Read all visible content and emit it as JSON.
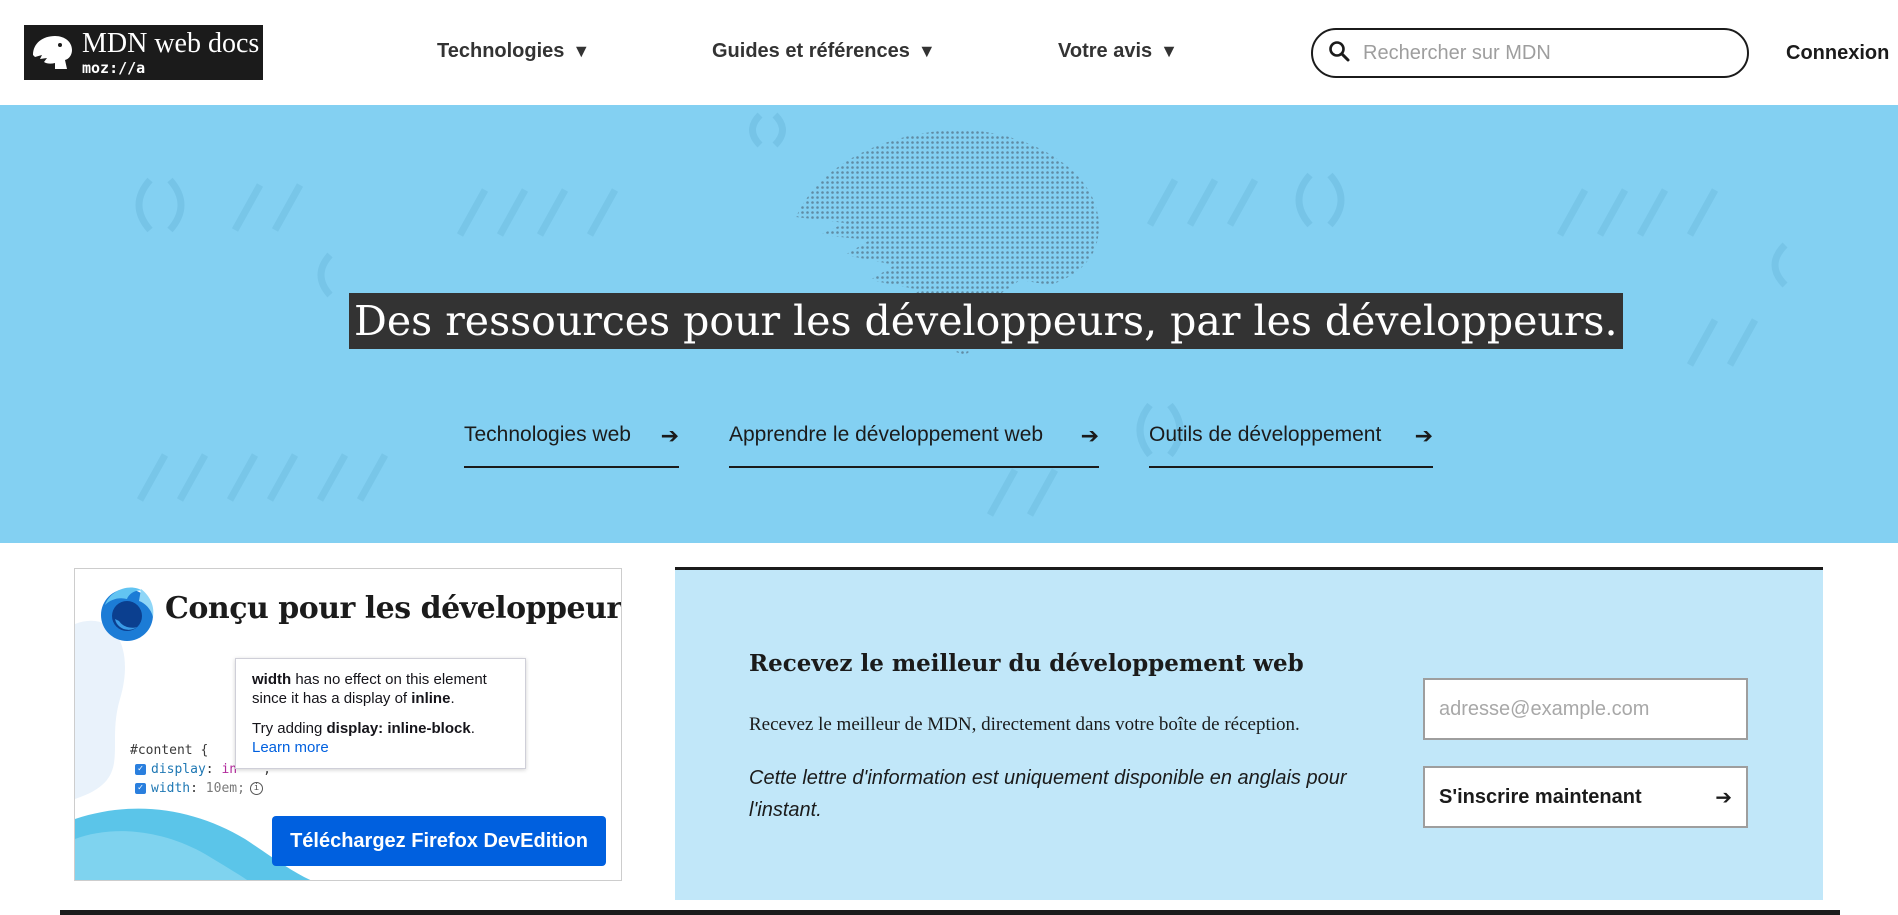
{
  "header": {
    "logo": {
      "title": "MDN web docs",
      "subtitle": "moz://a"
    },
    "nav": [
      {
        "label": "Technologies",
        "caret": "▼"
      },
      {
        "label": "Guides et références",
        "caret": "▼"
      },
      {
        "label": "Votre avis",
        "caret": "▼"
      }
    ],
    "search": {
      "placeholder": "Rechercher sur MDN",
      "icon": "search-icon"
    },
    "login": "Connexion"
  },
  "hero": {
    "title": "Des ressources pour les développeurs, par les développeurs.",
    "links": [
      {
        "label": "Technologies web",
        "arrow": "➔"
      },
      {
        "label": "Apprendre le développement web",
        "arrow": "➔"
      },
      {
        "label": "Outils de développement",
        "arrow": "➔"
      }
    ],
    "background_color": "#83d0f2"
  },
  "promo": {
    "title": "Conçu pour les développeurs",
    "tooltip": {
      "line1_bold": "width",
      "line1_rest": " has no effect on this element since it has a display of ",
      "line1_bold2": "inline",
      "line1_end": ".",
      "line2_start": "Try adding ",
      "line2_bold": "display: inline-block",
      "line2_end": ".",
      "learn_more": "Learn more"
    },
    "code": {
      "selector": "#content {",
      "prop1": "display",
      "val1": "in",
      "val1_tail": ";",
      "prop2": "width",
      "val2": "10em;",
      "colon": ":"
    },
    "button": "Téléchargez Firefox DevEdition",
    "button_color": "#0060df"
  },
  "newsletter": {
    "heading": "Recevez le meilleur du développement web",
    "subtitle": "Recevez le meilleur de MDN, directement dans votre boîte de réception.",
    "note": "Cette lettre d'information est uniquement disponible en anglais pour l'instant.",
    "email_placeholder": "adresse@example.com",
    "button": "S'inscrire maintenant",
    "button_arrow": "➔",
    "background_color": "#c1e7f9"
  }
}
